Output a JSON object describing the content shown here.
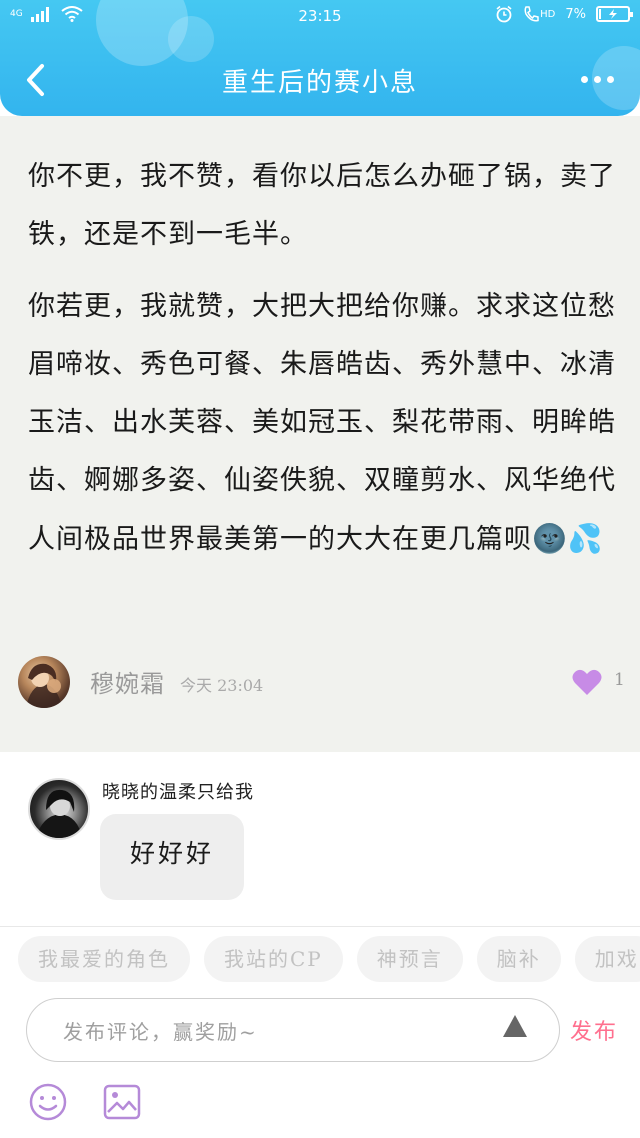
{
  "status_bar": {
    "network": "4G",
    "time": "23:15",
    "hd": "HD",
    "battery": "7%"
  },
  "header": {
    "title": "重生后的赛小息"
  },
  "post": {
    "paragraph1": "你不更，我不赞，看你以后怎么办砸了锅，卖了铁，还是不到一毛半。",
    "paragraph2": "你若更，我就赞，大把大把给你赚。求求这位愁眉啼妆、秀色可餐、朱唇皓齿、秀外慧中、冰清玉洁、出水芙蓉、美如冠玉、梨花带雨、明眸皓齿、婀娜多姿、仙姿佚貌、双瞳剪水、风华绝代 人间极品世界最美第一的大大在更几篇呗",
    "emoji": "🌚💦",
    "author": "穆婉霜",
    "time": "今天 23:04",
    "like_count": "1",
    "heart_color": "#c78be6"
  },
  "comment": {
    "user": "晓晓的温柔只给我",
    "text": "好好好"
  },
  "tags": [
    "我最爱的角色",
    "我站的CP",
    "神预言",
    "脑补",
    "加戏"
  ],
  "composer": {
    "placeholder": "发布评论，赢奖励~",
    "submit": "发布",
    "accent": "#ff6f8e"
  },
  "icons": {
    "emoji": "smile-icon",
    "image": "image-icon"
  }
}
